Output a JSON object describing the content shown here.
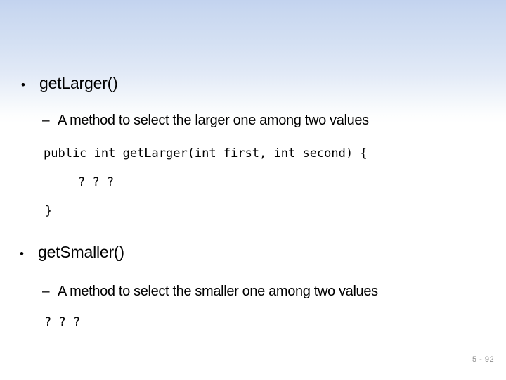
{
  "slide": {
    "page_number": "5 - 92",
    "background": {
      "gradient_top_color": "#c3d3ef",
      "gradient_bottom_color": "#ffffff"
    },
    "bullet_marker": "•",
    "dash_marker": "–",
    "blocks": [
      {
        "id": "get-larger",
        "title": "getLarger()",
        "description": "A method to select the larger one among two values",
        "code": [
          "public int getLarger(int first, int second) {",
          "? ? ?",
          "}"
        ]
      },
      {
        "id": "get-smaller",
        "title": "getSmaller()",
        "description": "A method to select the smaller one among two values",
        "code": [
          "? ? ?"
        ]
      }
    ]
  }
}
